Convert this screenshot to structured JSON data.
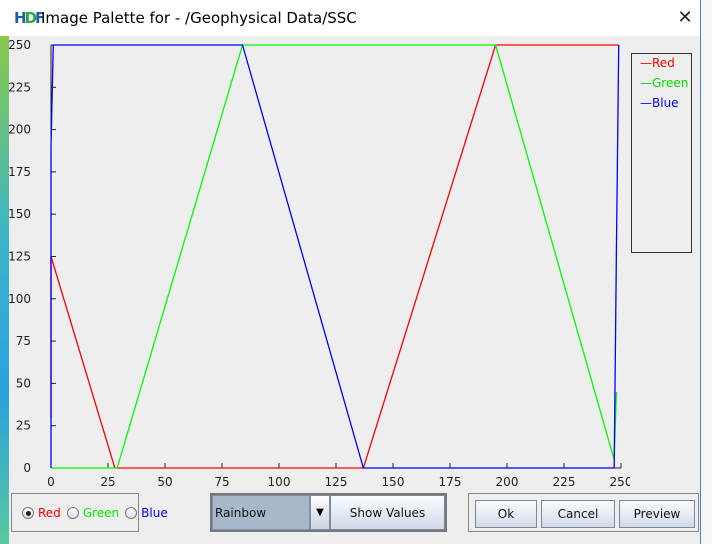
{
  "window": {
    "title": "Image Palette for - /Geophysical Data/SSC",
    "logo": "HDF",
    "close_icon": "close-icon"
  },
  "chart_data": {
    "type": "line",
    "xlim": [
      0,
      250
    ],
    "ylim": [
      0,
      250
    ],
    "xticks": [
      "0",
      "25",
      "50",
      "75",
      "100",
      "125",
      "150",
      "175",
      "200",
      "225",
      "250"
    ],
    "yticks": [
      "0",
      "25",
      "50",
      "75",
      "100",
      "125",
      "150",
      "175",
      "200",
      "225",
      "250"
    ],
    "legend_placement": "right",
    "series": [
      {
        "name": "Red",
        "color": "#ff0000",
        "points": [
          [
            0,
            30
          ],
          [
            0,
            125
          ],
          [
            28,
            0
          ],
          [
            137,
            0
          ],
          [
            195,
            255
          ],
          [
            249,
            255
          ]
        ]
      },
      {
        "name": "Green",
        "color": "#00ff00",
        "points": [
          [
            0,
            0
          ],
          [
            29,
            0
          ],
          [
            84,
            255
          ],
          [
            195,
            255
          ],
          [
            247,
            5
          ],
          [
            248,
            45
          ]
        ]
      },
      {
        "name": "Blue",
        "color": "#0000ff",
        "points": [
          [
            0,
            0
          ],
          [
            0,
            190
          ],
          [
            1,
            255
          ],
          [
            84,
            255
          ],
          [
            137,
            0
          ],
          [
            247,
            0
          ],
          [
            248,
            130
          ],
          [
            249,
            255
          ]
        ]
      }
    ]
  },
  "legend": {
    "items": [
      {
        "label": "Red",
        "color": "#ff0000"
      },
      {
        "label": "Green",
        "color": "#00ff00"
      },
      {
        "label": "Blue",
        "color": "#0000ff"
      }
    ]
  },
  "channel": {
    "options": [
      "Red",
      "Green",
      "Blue"
    ],
    "selected": "Red"
  },
  "palette": {
    "selected": "Rainbow",
    "show_values": "Show Values"
  },
  "buttons": {
    "ok": "Ok",
    "cancel": "Cancel",
    "preview": "Preview"
  }
}
